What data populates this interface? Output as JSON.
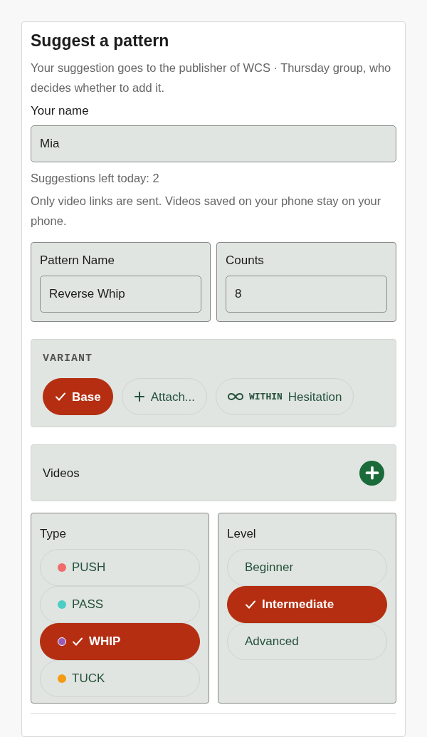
{
  "title": "Suggest a pattern",
  "description": "Your suggestion goes to the publisher of WCS · Thursday group, who decides whether to add it.",
  "name_field": {
    "label": "Your name",
    "value": "Mia"
  },
  "suggestions_left": "Suggestions left today: 2",
  "video_note": "Only video links are sent. Videos saved on your phone stay on your phone.",
  "pattern_name": {
    "label": "Pattern Name",
    "value": "Reverse Whip"
  },
  "counts": {
    "label": "Counts",
    "value": "8"
  },
  "variant": {
    "label": "VARIANT",
    "chips": [
      {
        "kind": "check",
        "label": "Base",
        "selected": true
      },
      {
        "kind": "plus",
        "label": "Attach...",
        "selected": false
      },
      {
        "kind": "infinity",
        "prefix": "WITHIN",
        "label": "Hesitation",
        "selected": false
      }
    ]
  },
  "videos": {
    "label": "Videos"
  },
  "type": {
    "label": "Type",
    "options": [
      {
        "label": "PUSH",
        "color": "#f06b6b",
        "selected": false
      },
      {
        "label": "PASS",
        "color": "#4ecdc4",
        "selected": false
      },
      {
        "label": "WHIP",
        "color": "#9b59b6",
        "selected": true
      },
      {
        "label": "TUCK",
        "color": "#f39c12",
        "selected": false
      }
    ]
  },
  "level": {
    "label": "Level",
    "options": [
      {
        "label": "Beginner",
        "selected": false
      },
      {
        "label": "Intermediate",
        "selected": true
      },
      {
        "label": "Advanced",
        "selected": false
      }
    ]
  }
}
